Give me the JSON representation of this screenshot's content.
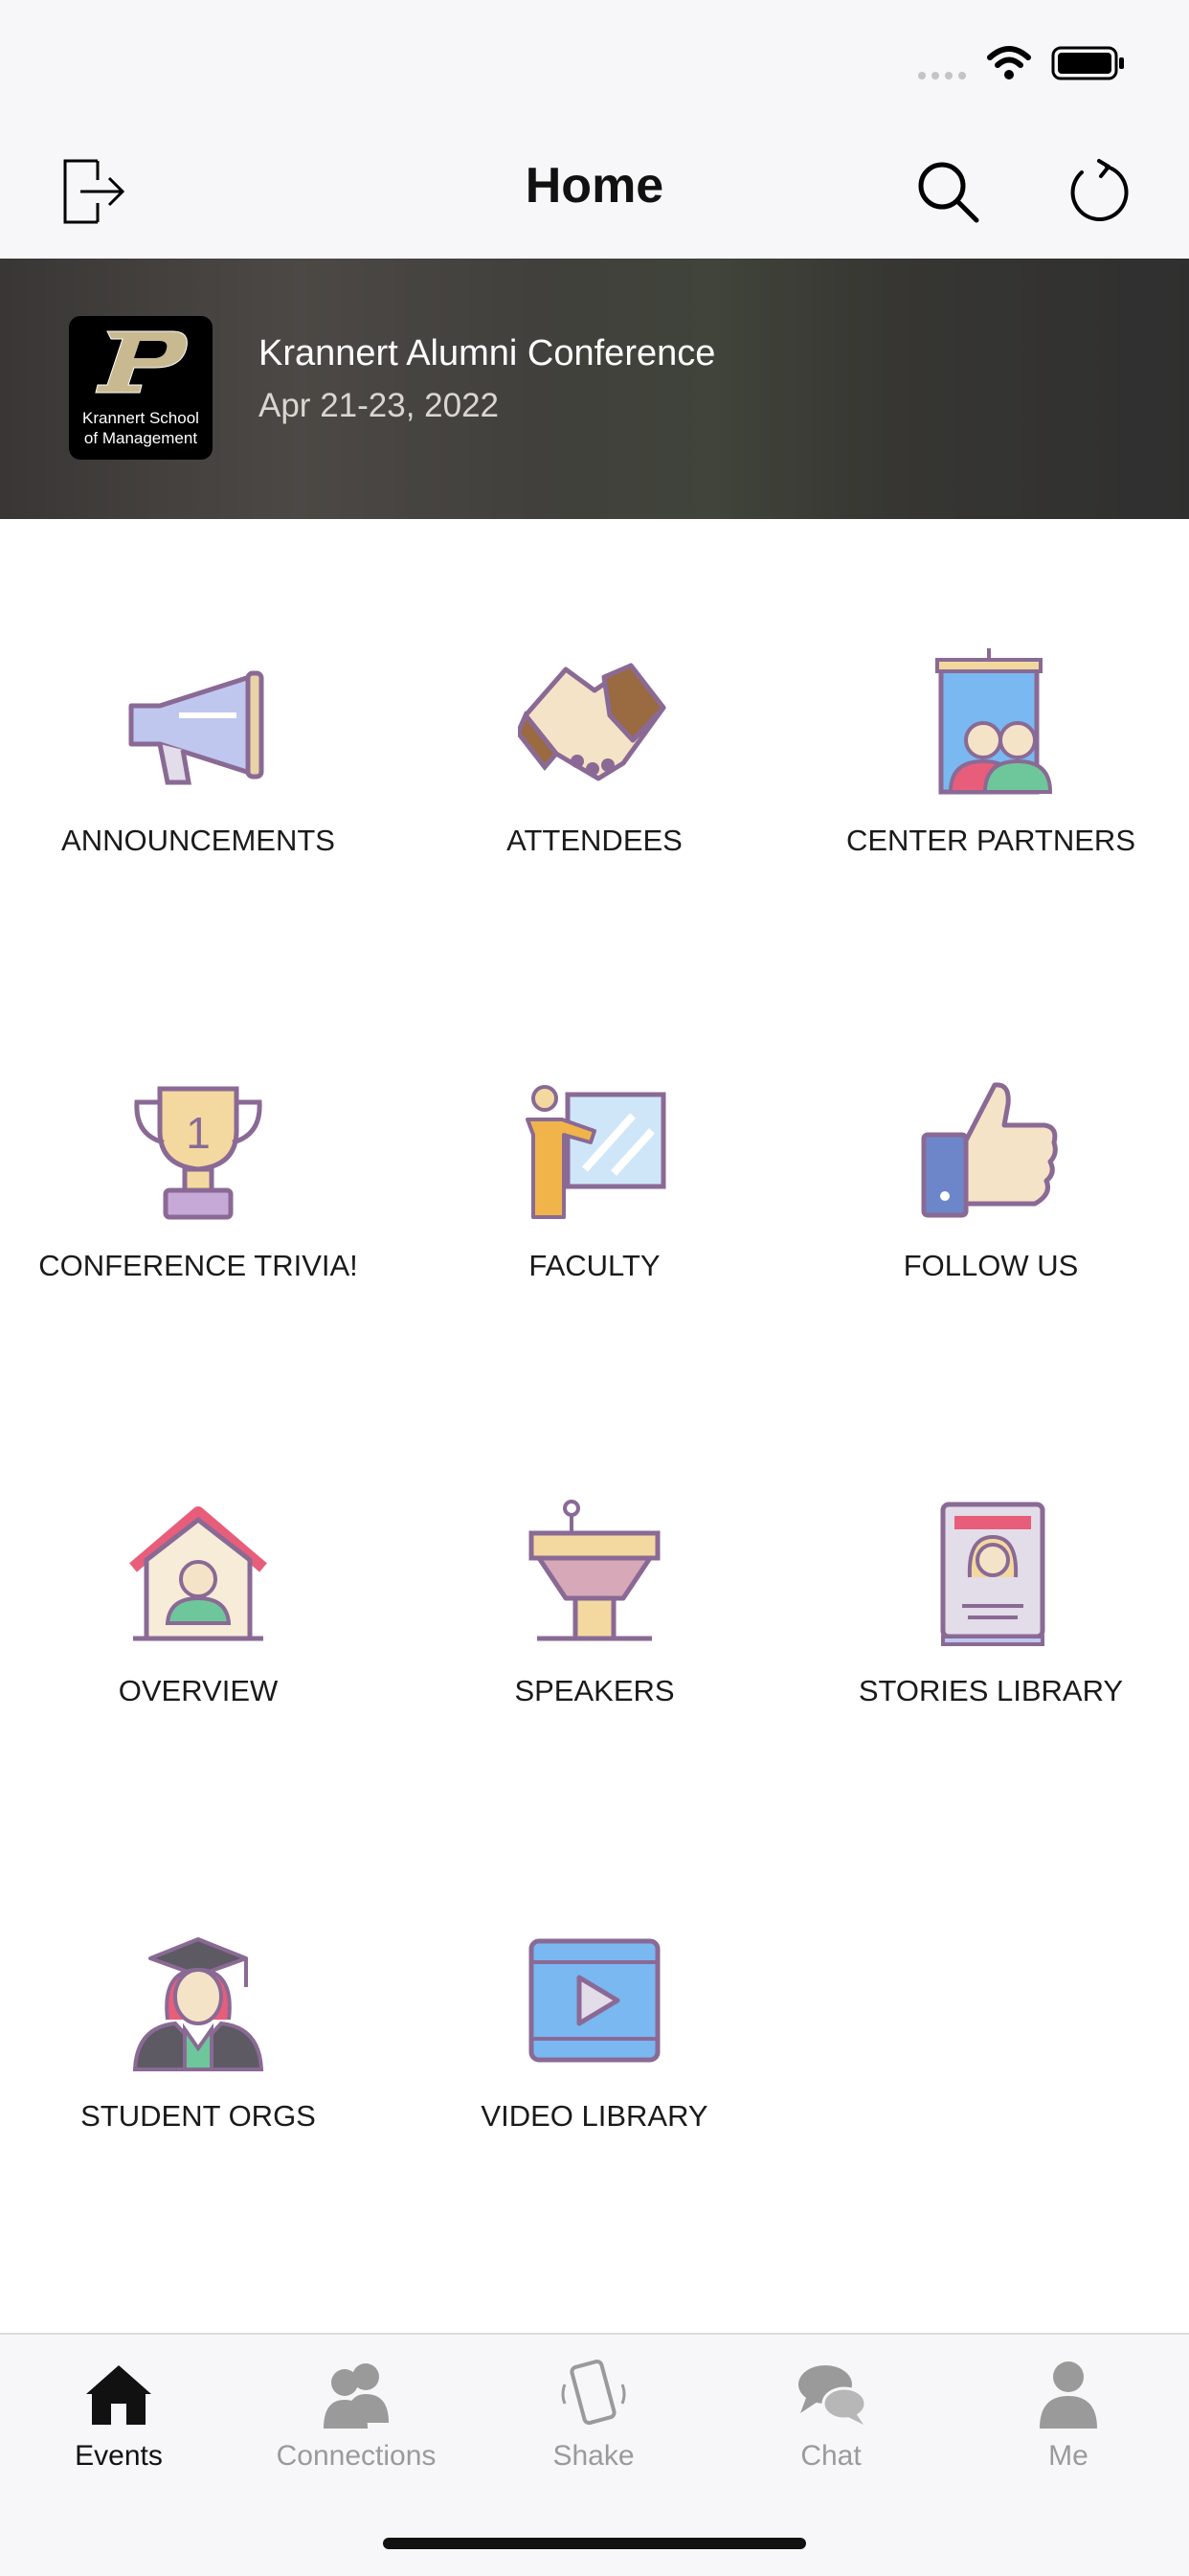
{
  "header": {
    "title": "Home"
  },
  "event": {
    "title": "Krannert Alumni Conference",
    "date": "Apr 21-23, 2022",
    "logo_caption_1": "Krannert School",
    "logo_caption_2": "of Management"
  },
  "tiles": [
    {
      "label": "ANNOUNCEMENTS",
      "icon": "megaphone-icon"
    },
    {
      "label": "ATTENDEES",
      "icon": "handshake-icon"
    },
    {
      "label": "CENTER PARTNERS",
      "icon": "building-people-icon"
    },
    {
      "label": "CONFERENCE TRIVIA!",
      "icon": "trophy-icon"
    },
    {
      "label": "FACULTY",
      "icon": "presenter-board-icon"
    },
    {
      "label": "FOLLOW US",
      "icon": "thumbs-up-icon"
    },
    {
      "label": "OVERVIEW",
      "icon": "house-person-icon"
    },
    {
      "label": "SPEAKERS",
      "icon": "podium-icon"
    },
    {
      "label": "STORIES LIBRARY",
      "icon": "storybook-icon"
    },
    {
      "label": "STUDENT ORGS",
      "icon": "graduate-icon"
    },
    {
      "label": "VIDEO LIBRARY",
      "icon": "video-icon"
    }
  ],
  "tabs": [
    {
      "label": "Events",
      "active": true
    },
    {
      "label": "Connections",
      "active": false
    },
    {
      "label": "Shake",
      "active": false
    },
    {
      "label": "Chat",
      "active": false
    },
    {
      "label": "Me",
      "active": false
    }
  ],
  "colors": {
    "bar_bg": "#f7f6f8",
    "active_tab": "#111111",
    "inactive_tab": "#9a9a9a",
    "icon_outline": "#8a6a95"
  }
}
